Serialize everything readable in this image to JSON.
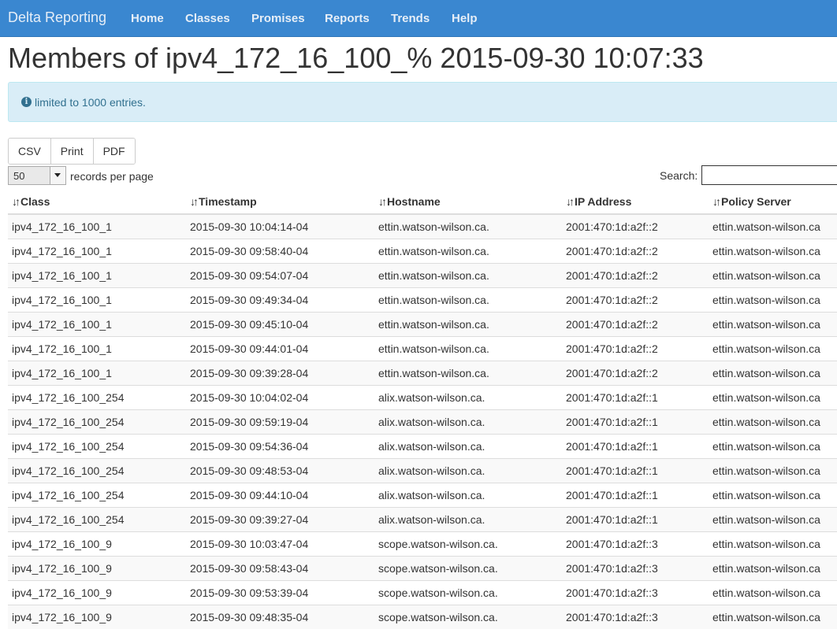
{
  "navbar": {
    "brand": "Delta Reporting",
    "items": [
      "Home",
      "Classes",
      "Promises",
      "Reports",
      "Trends",
      "Help"
    ]
  },
  "page": {
    "title": "Members of ipv4_172_16_100_% 2015-09-30 10:07:33"
  },
  "alert": {
    "icon": "info-circle-icon",
    "text": "limited to 1000 entries."
  },
  "export_buttons": [
    "CSV",
    "Print",
    "PDF"
  ],
  "length": {
    "value": "50",
    "label": "records per page"
  },
  "search": {
    "label": "Search:",
    "value": ""
  },
  "table": {
    "columns": [
      "Class",
      "Timestamp",
      "Hostname",
      "IP Address",
      "Policy Server"
    ],
    "rows": [
      [
        "ipv4_172_16_100_1",
        "2015-09-30 10:04:14-04",
        "ettin.watson-wilson.ca.",
        "2001:470:1d:a2f::2",
        "ettin.watson-wilson.ca"
      ],
      [
        "ipv4_172_16_100_1",
        "2015-09-30 09:58:40-04",
        "ettin.watson-wilson.ca.",
        "2001:470:1d:a2f::2",
        "ettin.watson-wilson.ca"
      ],
      [
        "ipv4_172_16_100_1",
        "2015-09-30 09:54:07-04",
        "ettin.watson-wilson.ca.",
        "2001:470:1d:a2f::2",
        "ettin.watson-wilson.ca"
      ],
      [
        "ipv4_172_16_100_1",
        "2015-09-30 09:49:34-04",
        "ettin.watson-wilson.ca.",
        "2001:470:1d:a2f::2",
        "ettin.watson-wilson.ca"
      ],
      [
        "ipv4_172_16_100_1",
        "2015-09-30 09:45:10-04",
        "ettin.watson-wilson.ca.",
        "2001:470:1d:a2f::2",
        "ettin.watson-wilson.ca"
      ],
      [
        "ipv4_172_16_100_1",
        "2015-09-30 09:44:01-04",
        "ettin.watson-wilson.ca.",
        "2001:470:1d:a2f::2",
        "ettin.watson-wilson.ca"
      ],
      [
        "ipv4_172_16_100_1",
        "2015-09-30 09:39:28-04",
        "ettin.watson-wilson.ca.",
        "2001:470:1d:a2f::2",
        "ettin.watson-wilson.ca"
      ],
      [
        "ipv4_172_16_100_254",
        "2015-09-30 10:04:02-04",
        "alix.watson-wilson.ca.",
        "2001:470:1d:a2f::1",
        "ettin.watson-wilson.ca"
      ],
      [
        "ipv4_172_16_100_254",
        "2015-09-30 09:59:19-04",
        "alix.watson-wilson.ca.",
        "2001:470:1d:a2f::1",
        "ettin.watson-wilson.ca"
      ],
      [
        "ipv4_172_16_100_254",
        "2015-09-30 09:54:36-04",
        "alix.watson-wilson.ca.",
        "2001:470:1d:a2f::1",
        "ettin.watson-wilson.ca"
      ],
      [
        "ipv4_172_16_100_254",
        "2015-09-30 09:48:53-04",
        "alix.watson-wilson.ca.",
        "2001:470:1d:a2f::1",
        "ettin.watson-wilson.ca"
      ],
      [
        "ipv4_172_16_100_254",
        "2015-09-30 09:44:10-04",
        "alix.watson-wilson.ca.",
        "2001:470:1d:a2f::1",
        "ettin.watson-wilson.ca"
      ],
      [
        "ipv4_172_16_100_254",
        "2015-09-30 09:39:27-04",
        "alix.watson-wilson.ca.",
        "2001:470:1d:a2f::1",
        "ettin.watson-wilson.ca"
      ],
      [
        "ipv4_172_16_100_9",
        "2015-09-30 10:03:47-04",
        "scope.watson-wilson.ca.",
        "2001:470:1d:a2f::3",
        "ettin.watson-wilson.ca"
      ],
      [
        "ipv4_172_16_100_9",
        "2015-09-30 09:58:43-04",
        "scope.watson-wilson.ca.",
        "2001:470:1d:a2f::3",
        "ettin.watson-wilson.ca"
      ],
      [
        "ipv4_172_16_100_9",
        "2015-09-30 09:53:39-04",
        "scope.watson-wilson.ca.",
        "2001:470:1d:a2f::3",
        "ettin.watson-wilson.ca"
      ],
      [
        "ipv4_172_16_100_9",
        "2015-09-30 09:48:35-04",
        "scope.watson-wilson.ca.",
        "2001:470:1d:a2f::3",
        "ettin.watson-wilson.ca"
      ]
    ]
  },
  "colors": {
    "navbar": "#3a87d0",
    "alert_bg": "#d9edf7",
    "alert_text": "#31708f",
    "stripe": "#f9f9f9"
  }
}
